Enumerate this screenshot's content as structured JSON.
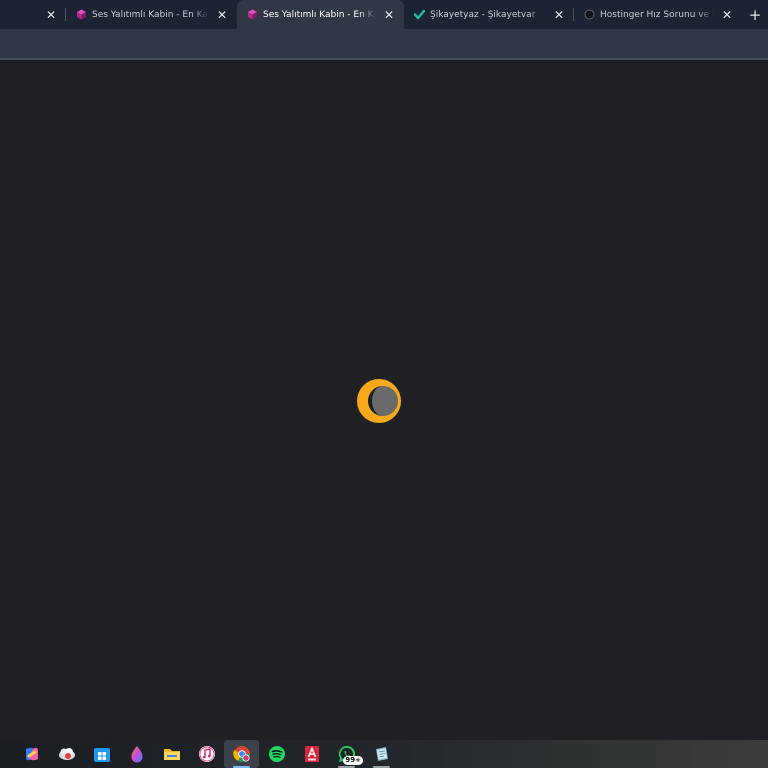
{
  "tabs": [
    {
      "title": "",
      "active": false,
      "favicon": "none"
    },
    {
      "title": "Ses Yalıtımlı Kabin - En Kaliteli Ses",
      "active": false,
      "favicon": "magenta-cube-icon"
    },
    {
      "title": "Ses Yalıtımlı Kabin - En Kaliteli Ses",
      "active": true,
      "favicon": "magenta-cube-icon"
    },
    {
      "title": "Şikayetyaz - Şikayetvar",
      "active": false,
      "favicon": "teal-check-icon"
    },
    {
      "title": "Hostinger Hız Sorunu ve Müşteri",
      "active": false,
      "favicon": "dark-circle-icon"
    }
  ],
  "tab_close_glyph": "✕",
  "new_tab_glyph": "+",
  "content": {
    "loading_indicator": "moon-spinner-icon",
    "colors": {
      "background": "#1f2023",
      "spinner_outer": "#f7a81b",
      "spinner_inner": "#6a6a6a"
    }
  },
  "taskbar": {
    "items": [
      {
        "name": "copilot-icon",
        "active": false,
        "running": false
      },
      {
        "name": "cloud-drive-icon",
        "active": false,
        "running": false
      },
      {
        "name": "store-icon",
        "active": false,
        "running": false
      },
      {
        "name": "water-drop-app-icon",
        "active": false,
        "running": false
      },
      {
        "name": "file-explorer-icon",
        "active": false,
        "running": false
      },
      {
        "name": "itunes-icon",
        "active": false,
        "running": false
      },
      {
        "name": "chrome-icon",
        "active": true,
        "running": true
      },
      {
        "name": "spotify-icon",
        "active": false,
        "running": false
      },
      {
        "name": "autocad-icon",
        "active": false,
        "running": false
      },
      {
        "name": "whatsapp-icon",
        "active": false,
        "running": true,
        "badge": "99+"
      },
      {
        "name": "notes-app-icon",
        "active": false,
        "running": true
      }
    ]
  }
}
